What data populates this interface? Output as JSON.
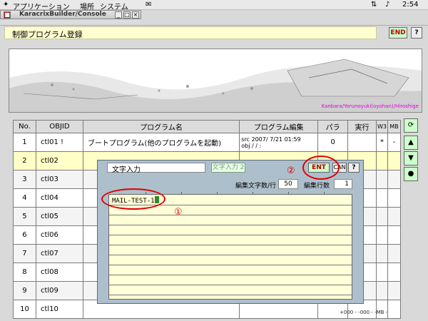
{
  "system": {
    "menus": [
      "アプリケーション",
      "場所",
      "システム"
    ],
    "clock": "2:54"
  },
  "window": {
    "title": "KaracrixBuilder/Console"
  },
  "header": {
    "title": "制御プログラム登録",
    "end_label": "END",
    "help_label": "?"
  },
  "banner": {
    "caption": "Kanbara/Yorunoyuki(oyohan)/Hiroshige"
  },
  "table": {
    "headers": [
      "No.",
      "OBJID",
      "プログラム名",
      "プログラム編集",
      "パラ",
      "実行",
      "W3",
      "MB"
    ],
    "rows": [
      {
        "no": "1",
        "objid": "ctl01 !",
        "name": "ブートプログラム(他のプログラムを起動)",
        "edit": "src 2007/ 7/21 01:59\nobj / / :",
        "para": "0",
        "exec": "",
        "w3": "*",
        "mb": "-"
      },
      {
        "no": "2",
        "objid": "ctl02"
      },
      {
        "no": "3",
        "objid": "ctl03"
      },
      {
        "no": "4",
        "objid": "ctl04"
      },
      {
        "no": "5",
        "objid": "ctl05"
      },
      {
        "no": "6",
        "objid": "ctl06"
      },
      {
        "no": "7",
        "objid": "ctl07"
      },
      {
        "no": "8",
        "objid": "ctl08"
      },
      {
        "no": "9",
        "objid": "ctl09"
      },
      {
        "no": "10",
        "objid": "ctl10"
      }
    ]
  },
  "footer": {
    "text": "+000 - -000 - -MB -"
  },
  "dialog": {
    "title": "文字入力",
    "tab_label": "文字入力 2",
    "ent_label": "ENT",
    "can_label": "CAN",
    "help_label": "?",
    "cols_label": "編集文字数/行",
    "cols_value": "50",
    "rows_label": "編集行数",
    "rows_value": "1",
    "text": "MAIL-TEST-1"
  },
  "annotations": {
    "marker1": "①",
    "marker2": "②"
  },
  "colors": {
    "accent_red": "#e00000",
    "button_green": "#ccffcc",
    "editor_yellow": "#ffffd8"
  }
}
